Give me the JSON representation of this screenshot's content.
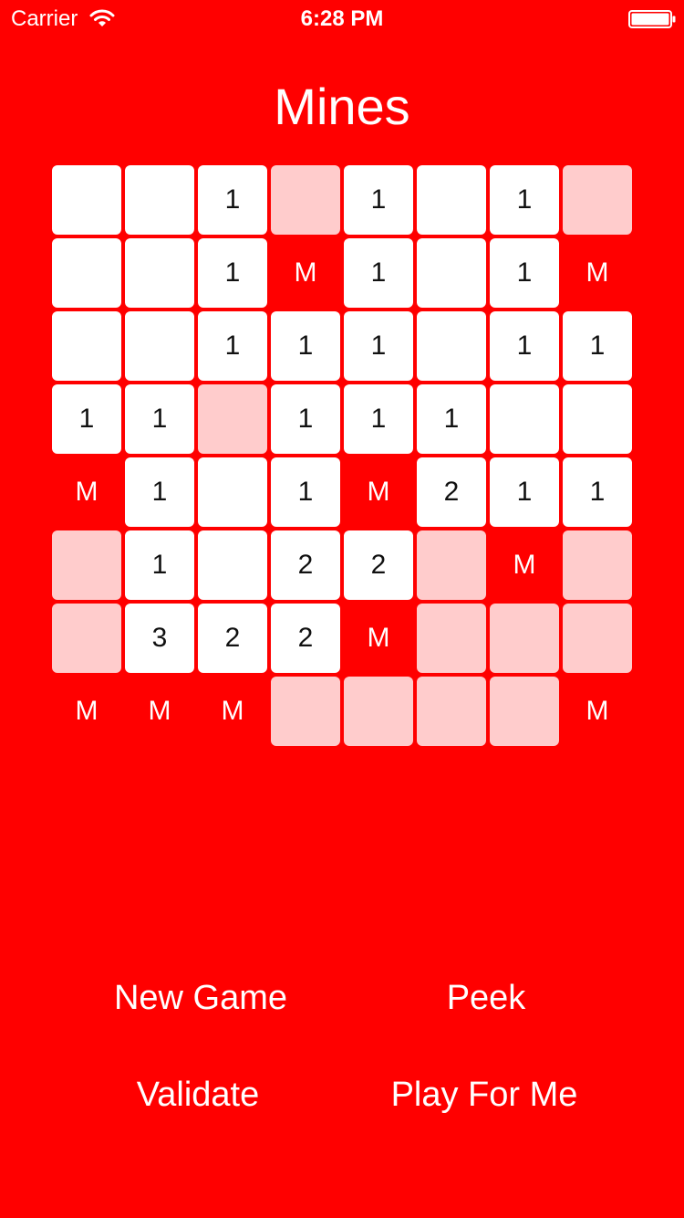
{
  "status_bar": {
    "carrier": "Carrier",
    "time": "6:28 PM",
    "wifi_icon": "wifi-icon",
    "battery_icon": "battery-icon"
  },
  "title": "Mines",
  "colors": {
    "background": "#FF0000",
    "revealed_cell": "#FFFFFF",
    "hidden_cell": "#FFCCCC",
    "text_light": "#FFFFFF",
    "text_dark": "#111111"
  },
  "board": {
    "legend": {
      "empty_revealed": "",
      "hidden": "#",
      "mine": "M"
    },
    "rows": [
      [
        "",
        "",
        "1",
        "#",
        "1",
        "",
        "1",
        "#"
      ],
      [
        "",
        "",
        "1",
        "M",
        "1",
        "",
        "1",
        "M"
      ],
      [
        "",
        "",
        "1",
        "1",
        "1",
        "",
        "1",
        "1"
      ],
      [
        "1",
        "1",
        "#",
        "1",
        "1",
        "1",
        "",
        ""
      ],
      [
        "M",
        "1",
        "",
        "1",
        "M",
        "2",
        "1",
        "1"
      ],
      [
        "#",
        "1",
        "",
        "2",
        "2",
        "#",
        "M",
        "#"
      ],
      [
        "#",
        "3",
        "2",
        "2",
        "M",
        "#",
        "#",
        "#"
      ],
      [
        "M",
        "M",
        "M",
        "#",
        "#",
        "#",
        "#",
        "M"
      ]
    ]
  },
  "buttons": {
    "new_game": "New Game",
    "peek": "Peek",
    "validate": "Validate",
    "play_for_me": "Play For Me"
  }
}
